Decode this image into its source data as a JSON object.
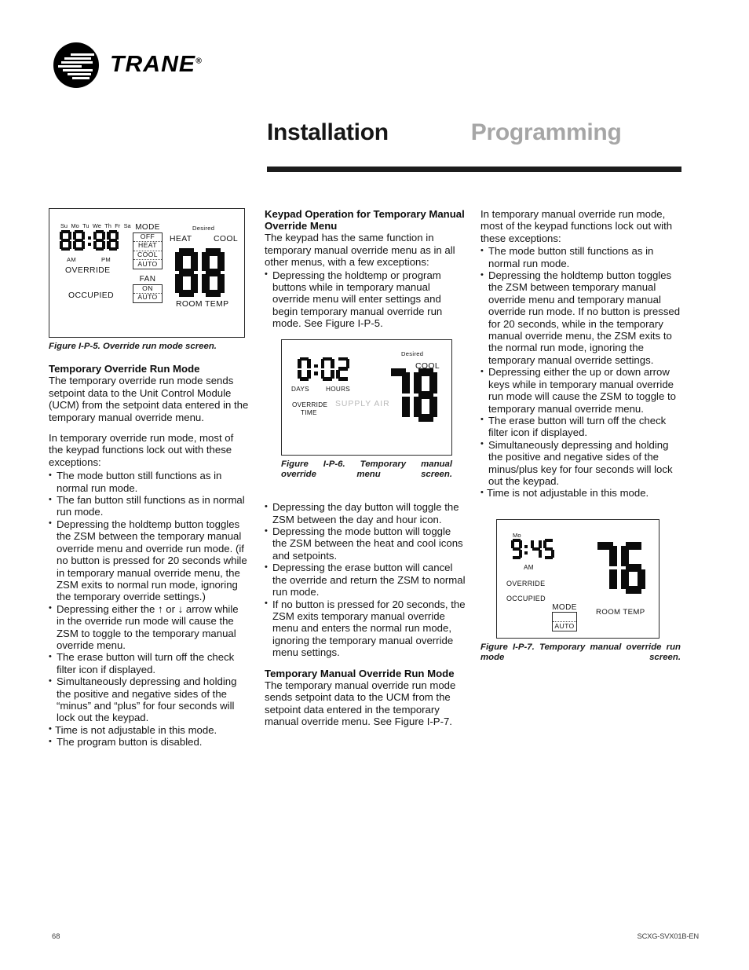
{
  "logo": {
    "wordmark": "TRANE",
    "trademark": "®"
  },
  "header": {
    "title_primary": "Installation",
    "title_secondary": "Programming"
  },
  "figures": {
    "fig5": {
      "caption": "Figure I-P-5. Override run mode screen.",
      "days": [
        "Su",
        "Mo",
        "Tu",
        "We",
        "Th",
        "Fr",
        "Sa"
      ],
      "time": "88:88",
      "am_label": "AM",
      "pm_label": "PM",
      "override_label": "OVERRIDE",
      "occupied_label": "OCCUPIED",
      "mode_title": "MODE",
      "mode_options": [
        "OFF",
        "HEAT",
        "COOL",
        "AUTO"
      ],
      "fan_title": "FAN",
      "fan_options": [
        "ON",
        "AUTO"
      ],
      "desired_label": "Desired",
      "heat_label": "HEAT",
      "cool_label": "COOL",
      "temp": "88",
      "room_temp_label": "ROOM TEMP"
    },
    "fig6": {
      "caption": "Figure I-P-6. Temporary manual override menu screen.",
      "time": "0:02",
      "days_label": "DAYS",
      "hours_label": "HOURS",
      "override_label": "OVERRIDE",
      "time_label": "TIME",
      "supply_air_label": "SUPPLY AIR",
      "desired_label": "Desired",
      "cool_label": "COOL",
      "temp": "78"
    },
    "fig7": {
      "caption": "Figure I-P-7. Temporary manual override run mode screen.",
      "day": "Mo",
      "time": "9:45",
      "am_label": "AM",
      "override_label": "OVERRIDE",
      "occupied_label": "OCCUPIED",
      "mode_title": "MODE",
      "mode_options": [
        "",
        "AUTO"
      ],
      "temp": "76",
      "room_temp_label": "ROOM TEMP"
    }
  },
  "col_left": {
    "heading": "Temporary Override Run Mode",
    "para1": "The temporary override run mode sends setpoint data to the Unit Control Module (UCM) from the setpoint data entered in the temporary manual override menu.",
    "para2": "In temporary override run mode, most of the keypad functions lock out with these exceptions:",
    "bullets": [
      "The mode button still functions as in normal run mode.",
      "The fan button still functions as in normal run mode.",
      "Depressing the holdtemp button toggles the ZSM between the temporary manual override menu and override run mode. (if no button is pressed for 20 seconds while in temporary manual override menu, the ZSM exits to normal run mode, ignoring the temporary override settings.)",
      "Depressing either the ↑ or ↓ arrow while in the override run mode will cause the ZSM to toggle to the temporary manual override menu.",
      "The erase button will turn off the check filter icon if displayed.",
      "Simultaneously depressing and holding the positive and negative sides of the “minus” and “plus” for four seconds will lock out the keypad.",
      "Time is not adjustable in this mode.",
      "The program button is disabled."
    ]
  },
  "col_mid": {
    "heading": "Keypad Operation for Temporary Manual Override Menu",
    "para1": "The keypad has the same function in temporary manual override menu as in all other menus, with a few exceptions:",
    "bullets_top": [
      "Depressing the holdtemp or program buttons while in temporary manual override menu will enter settings and begin temporary manual override run mode. See Figure I-P-5."
    ],
    "bullets_bottom": [
      "Depressing the day button will toggle the ZSM between the day and hour icon.",
      "Depressing the mode button will toggle the ZSM between the heat and cool icons and setpoints.",
      "Depressing the erase button will cancel the override and return the ZSM to normal run mode.",
      "If no button is pressed for 20 seconds, the ZSM exits temporary manual override menu and enters the normal run mode, ignoring the temporary manual override menu settings."
    ],
    "heading2": "Temporary Manual Override Run Mode",
    "para2": "The temporary manual override run mode sends setpoint data to the UCM from the setpoint data entered in the temporary manual override menu. See Figure I-P-7."
  },
  "col_right": {
    "para1": "In temporary manual override run mode, most of the keypad functions lock out with these exceptions:",
    "bullets": [
      "The mode button still functions as in normal run mode.",
      "Depressing the holdtemp button toggles the ZSM between temporary manual override menu and temporary manual override run mode. If no button is pressed for 20 seconds, while in the temporary manual override menu, the ZSM exits to the normal run mode, ignoring the temporary manual override settings.",
      "Depressing either the up or down arrow keys while in temporary manual override run mode will cause the ZSM to toggle to temporary manual override menu.",
      "The erase button will turn off the check filter icon if displayed.",
      "Simultaneously depressing and holding the positive and negative sides of the minus/plus key for four seconds will lock out the keypad.",
      "Time is not adjustable in this mode."
    ]
  },
  "footer": {
    "page_number": "68",
    "document_code": "SCXG-SVX01B-EN"
  }
}
